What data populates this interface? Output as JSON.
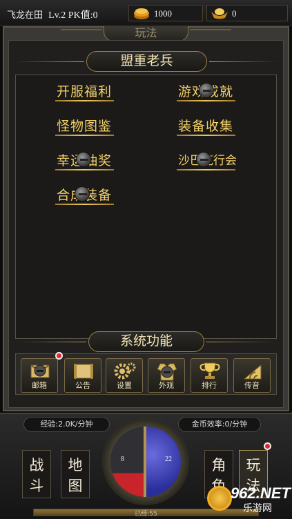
{
  "topbar": {
    "player_name": "飞龙在田",
    "level": "Lv.2 PK值:0",
    "gold": "1000",
    "ingot": "0"
  },
  "panel": {
    "header": "玩法",
    "section1_title": "盟重老兵",
    "features": [
      {
        "label": "开服福利"
      },
      {
        "label": "游戏成就"
      },
      {
        "label": "怪物图鉴"
      },
      {
        "label": "装备收集"
      },
      {
        "label": "幸运抽奖"
      },
      {
        "label": "沙巴克行会"
      },
      {
        "label": "合成装备"
      }
    ],
    "section2_title": "系统功能",
    "system_buttons": [
      {
        "label": "邮箱",
        "icon": "mailbox-icon"
      },
      {
        "label": "公告",
        "icon": "scroll-icon"
      },
      {
        "label": "设置",
        "icon": "gear-icon"
      },
      {
        "label": "外观",
        "icon": "outfit-icon"
      },
      {
        "label": "排行",
        "icon": "trophy-icon"
      },
      {
        "label": "传音",
        "icon": "signal-icon"
      }
    ]
  },
  "hud": {
    "exp_rate": "经验:2.0K/分钟",
    "coin_rate": "金币效率:0/分钟",
    "hp_value": "8",
    "mp_value": "22",
    "exp_bar_text": "已经:55",
    "buttons": [
      "战斗",
      "地图",
      "角色",
      "玩法"
    ]
  },
  "watermark": {
    "brand": "962.NET",
    "sub": "乐游网"
  },
  "colors": {
    "accent_gold": "#f2d068",
    "badge_red": "#e3262b",
    "hp_red": "#c9242a",
    "mp_blue": "#3a3dbd"
  }
}
